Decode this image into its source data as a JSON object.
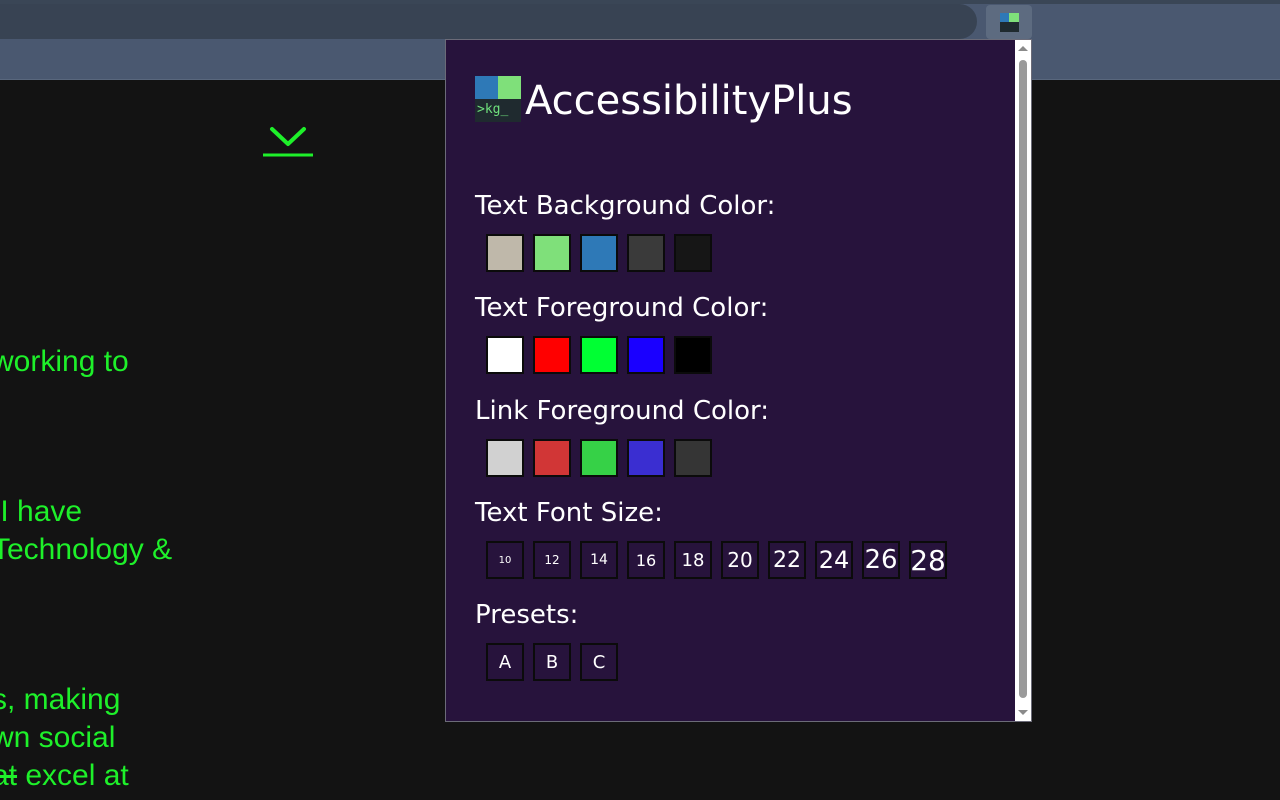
{
  "browser": {
    "extension_button_icon": "accessibilityplus-icon"
  },
  "page": {
    "download_icon": "download-icon",
    "text_lines": [
      {
        "text": "working to"
      },
      {
        "text": " I have"
      },
      {
        "text": "Technology &"
      },
      {
        "text": "s, making"
      },
      {
        "text": "wn social"
      },
      {
        "text_strike": "at",
        "text": " excel at"
      }
    ],
    "text_color": "#1ef02a",
    "background_color": "#131313"
  },
  "popup": {
    "logo_text": ">kg_",
    "title": "AccessibilityPlus",
    "background_color": "#27133c",
    "text_background": {
      "label": "Text Background Color:",
      "swatches": [
        "#bfb8aa",
        "#7fe07a",
        "#2e79b7",
        "#3a3a3a",
        "#161616"
      ]
    },
    "text_foreground": {
      "label": "Text Foreground Color:",
      "swatches": [
        "#ffffff",
        "#ff0000",
        "#00ff33",
        "#1a00ff",
        "#000000"
      ]
    },
    "link_foreground": {
      "label": "Link Foreground Color:",
      "swatches": [
        "#d1d1d1",
        "#d13636",
        "#36d147",
        "#3a2ed1",
        "#353535"
      ]
    },
    "font_size": {
      "label": "Text Font Size:",
      "sizes": [
        "10",
        "12",
        "14",
        "16",
        "18",
        "20",
        "22",
        "24",
        "26",
        "28"
      ]
    },
    "presets": {
      "label": "Presets:",
      "items": [
        "A",
        "B",
        "C"
      ]
    }
  }
}
